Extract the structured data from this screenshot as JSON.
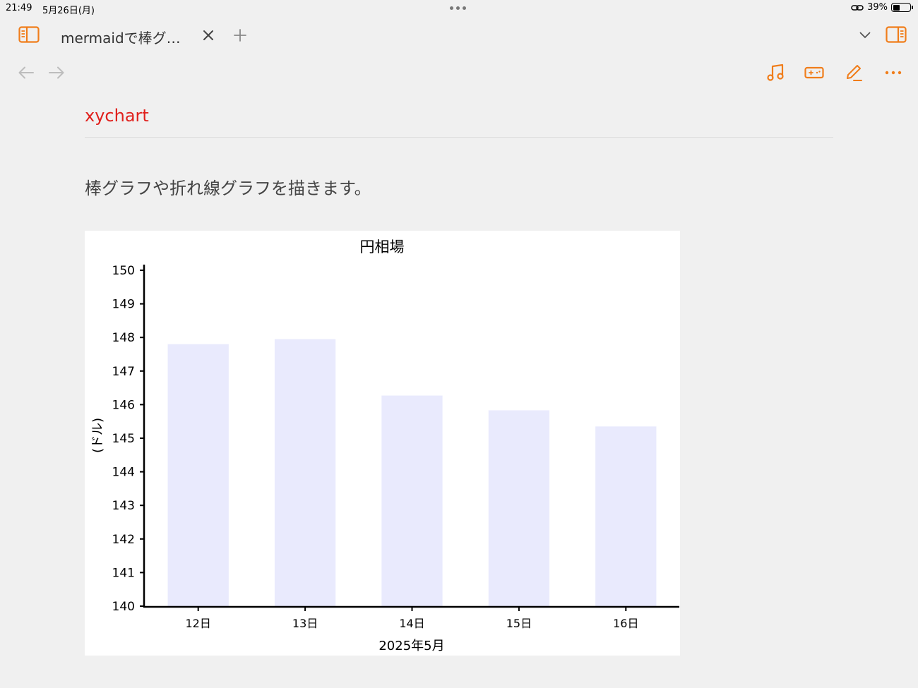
{
  "status": {
    "time": "21:49",
    "date": "5月26日(月)",
    "battery": "39%"
  },
  "tab": {
    "title": "mermaidで棒グ…"
  },
  "icons": {
    "sidebar_left": "sidebar-left-icon",
    "close": "close-icon",
    "add": "plus-icon",
    "chevron": "chevron-down-icon",
    "sidebar_right": "sidebar-right-icon",
    "back": "arrow-left-icon",
    "forward": "arrow-right-icon",
    "music": "music-note-icon",
    "game": "gamepad-icon",
    "edit": "pencil-icon",
    "more": "more-icon",
    "link": "link-icon"
  },
  "colors": {
    "accent": "#f07d1a",
    "heading": "#e0201c",
    "bar": "#e9eafd"
  },
  "doc": {
    "heading": "xychart",
    "paragraph": "棒グラフや折れ線グラフを描きます。"
  },
  "chart_data": {
    "type": "bar",
    "title": "円相場",
    "xlabel": "2025年5月",
    "ylabel": "(ドル)",
    "categories": [
      "12日",
      "13日",
      "14日",
      "15日",
      "16日"
    ],
    "values": [
      147.8,
      147.95,
      146.27,
      145.83,
      145.35
    ],
    "ylim": [
      140,
      150
    ],
    "yticks": [
      140,
      141,
      142,
      143,
      144,
      145,
      146,
      147,
      148,
      149,
      150
    ],
    "grid": false
  }
}
